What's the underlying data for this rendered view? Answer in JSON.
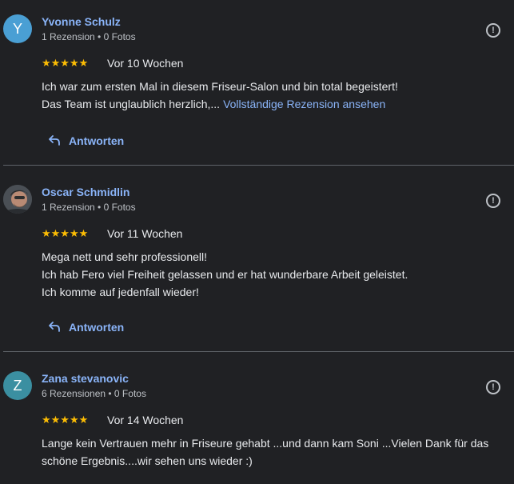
{
  "colors": {
    "background": "#202124",
    "link": "#8ab4f8",
    "star": "#fbbc04",
    "text": "#e8eaed",
    "muted": "#bdc1c6",
    "avatar_y": "#4a9fd4",
    "avatar_z": "#3b8fa1"
  },
  "reviews": [
    {
      "avatar_letter": "Y",
      "name": "Yvonne Schulz",
      "meta": "1 Rezension • 0 Fotos",
      "stars": "★★★★★",
      "rating": 5,
      "date": "Vor 10 Wochen",
      "text_lines": [
        "Ich war zum ersten Mal in diesem Friseur-Salon und bin total begeistert!",
        "Das Team ist unglaublich herzlich,..."
      ],
      "more_label": "Vollständige Rezension ansehen",
      "reply_label": "Antworten",
      "flag_icon": "report-flag-icon"
    },
    {
      "avatar_letter": "",
      "name": "Oscar Schmidlin",
      "meta": "1 Rezension • 0 Fotos",
      "stars": "★★★★★",
      "rating": 5,
      "date": "Vor 11 Wochen",
      "text_lines": [
        "Mega nett und sehr professionell!",
        "Ich hab Fero viel Freiheit gelassen und er hat wunderbare Arbeit geleistet.",
        "Ich komme auf jedenfall wieder!"
      ],
      "reply_label": "Antworten",
      "flag_icon": "report-flag-icon"
    },
    {
      "avatar_letter": "Z",
      "name": "Zana stevanovic",
      "meta": "6 Rezensionen • 0 Fotos",
      "stars": "★★★★★",
      "rating": 5,
      "date": "Vor 14 Wochen",
      "text_lines": [
        "Lange kein Vertrauen mehr in Friseure gehabt ...und dann kam Soni ...Vielen Dank für das",
        "schöne Ergebnis....wir sehen uns wieder :)"
      ],
      "flag_icon": "report-flag-icon"
    }
  ]
}
